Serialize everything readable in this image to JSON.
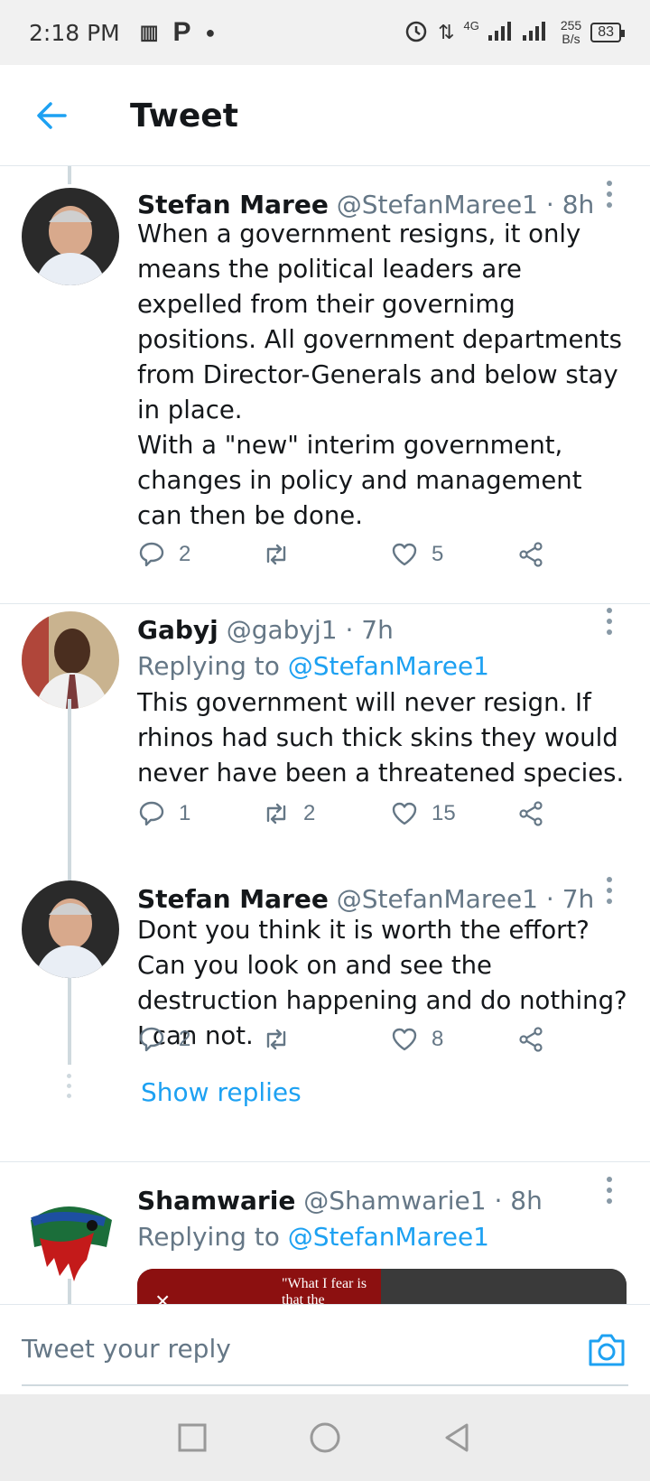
{
  "status_bar": {
    "time": "2:18 PM",
    "left_icons": [
      "sim-icon",
      "parking-icon",
      "dot-icon"
    ],
    "network": "4G",
    "net_speed_value": "255",
    "net_speed_unit": "B/s",
    "battery": "83"
  },
  "header": {
    "title": "Tweet",
    "back_icon": "back-arrow-icon"
  },
  "tweets": [
    {
      "name": "Stefan Maree",
      "handle": "@StefanMaree1",
      "time": "· 8h",
      "reply_prefix": "",
      "reply_to": "",
      "text": "When a government resigns, it only means the political leaders are expelled from their governimg positions. All government departments from Director-Generals and below stay in place.\nWith a \"new\" interim government, changes in policy and management can then be done.",
      "replies": "2",
      "retweets": "",
      "likes": "5"
    },
    {
      "name": "Gabyj",
      "handle": "@gabyj1",
      "time": "· 7h",
      "reply_prefix": "Replying to ",
      "reply_to": "@StefanMaree1",
      "text": "This government will never resign. If rhinos had such thick skins they would never have been a threatened species.",
      "replies": "1",
      "retweets": "2",
      "likes": "15"
    },
    {
      "name": "Stefan Maree",
      "handle": "@StefanMaree1",
      "time": "· 7h",
      "reply_prefix": "",
      "reply_to": "",
      "text": "Dont you think it is worth the effort? Can you look on and see the destruction happening and do nothing? I can not.",
      "replies": "2",
      "retweets": "",
      "likes": "8"
    },
    {
      "name": "Shamwarie",
      "handle": "@Shamwarie1",
      "time": "· 8h",
      "reply_prefix": "Replying to ",
      "reply_to": "@StefanMaree1",
      "media_caption": "\"What I fear is that the",
      "media_close": "×"
    }
  ],
  "show_replies": "Show replies",
  "composer": {
    "placeholder": "Tweet your reply",
    "camera_icon": "camera-icon"
  },
  "colors": {
    "accent": "#1da1f2",
    "secondary_text": "#657786",
    "divider": "#e1e8ed"
  }
}
